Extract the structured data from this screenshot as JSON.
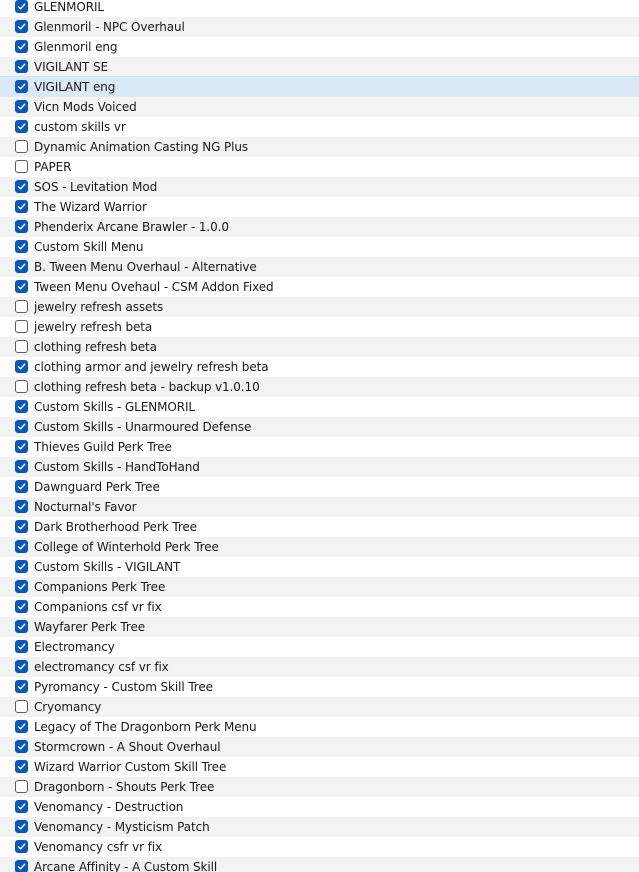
{
  "mod_list": {
    "accent_color": "#0a58b8",
    "check_icon": "checkmark-icon",
    "selected_index": 4,
    "items": [
      {
        "label": "GLENMORIL",
        "checked": true
      },
      {
        "label": "Glenmoril - NPC Overhaul",
        "checked": true
      },
      {
        "label": "Glenmoril eng",
        "checked": true
      },
      {
        "label": "VIGILANT SE",
        "checked": true
      },
      {
        "label": "VIGILANT eng",
        "checked": true
      },
      {
        "label": "Vicn Mods Voiced",
        "checked": true
      },
      {
        "label": "custom skills vr",
        "checked": true
      },
      {
        "label": "Dynamic Animation Casting NG Plus",
        "checked": false
      },
      {
        "label": "PAPER",
        "checked": false
      },
      {
        "label": "SOS - Levitation Mod",
        "checked": true
      },
      {
        "label": "The Wizard Warrior",
        "checked": true
      },
      {
        "label": "Phenderix Arcane Brawler - 1.0.0",
        "checked": true
      },
      {
        "label": "Custom Skill Menu",
        "checked": true
      },
      {
        "label": "B. Tween Menu Overhaul - Alternative",
        "checked": true
      },
      {
        "label": "Tween Menu Ovehaul - CSM Addon Fixed",
        "checked": true
      },
      {
        "label": "jewelry refresh assets",
        "checked": false
      },
      {
        "label": "jewelry refresh beta",
        "checked": false
      },
      {
        "label": "clothing refresh beta",
        "checked": false
      },
      {
        "label": "clothing armor and jewelry refresh beta",
        "checked": true
      },
      {
        "label": "clothing refresh beta - backup v1.0.10",
        "checked": false
      },
      {
        "label": "Custom Skills - GLENMORIL",
        "checked": true
      },
      {
        "label": "Custom Skills - Unarmoured Defense",
        "checked": true
      },
      {
        "label": "Thieves Guild Perk Tree",
        "checked": true
      },
      {
        "label": "Custom Skills - HandToHand",
        "checked": true
      },
      {
        "label": "Dawnguard Perk Tree",
        "checked": true
      },
      {
        "label": "Nocturnal's Favor",
        "checked": true
      },
      {
        "label": "Dark Brotherhood Perk Tree",
        "checked": true
      },
      {
        "label": "College of Winterhold Perk Tree",
        "checked": true
      },
      {
        "label": "Custom Skills - VIGILANT",
        "checked": true
      },
      {
        "label": "Companions Perk Tree",
        "checked": true
      },
      {
        "label": "Companions csf vr fix",
        "checked": true
      },
      {
        "label": "Wayfarer Perk Tree",
        "checked": true
      },
      {
        "label": "Electromancy",
        "checked": true
      },
      {
        "label": "electromancy csf vr fix",
        "checked": true
      },
      {
        "label": "Pyromancy - Custom Skill Tree",
        "checked": true
      },
      {
        "label": "Cryomancy",
        "checked": false
      },
      {
        "label": "Legacy of The Dragonborn Perk Menu",
        "checked": true
      },
      {
        "label": "Stormcrown - A Shout Overhaul",
        "checked": true
      },
      {
        "label": "Wizard Warrior Custom Skill Tree",
        "checked": true
      },
      {
        "label": "Dragonborn - Shouts Perk Tree",
        "checked": false
      },
      {
        "label": "Venomancy - Destruction",
        "checked": true
      },
      {
        "label": "Venomancy - Mysticism Patch",
        "checked": true
      },
      {
        "label": "Venomancy csfr vr fix",
        "checked": true
      },
      {
        "label": "Arcane Affinity - A Custom Skill",
        "checked": true
      }
    ]
  }
}
